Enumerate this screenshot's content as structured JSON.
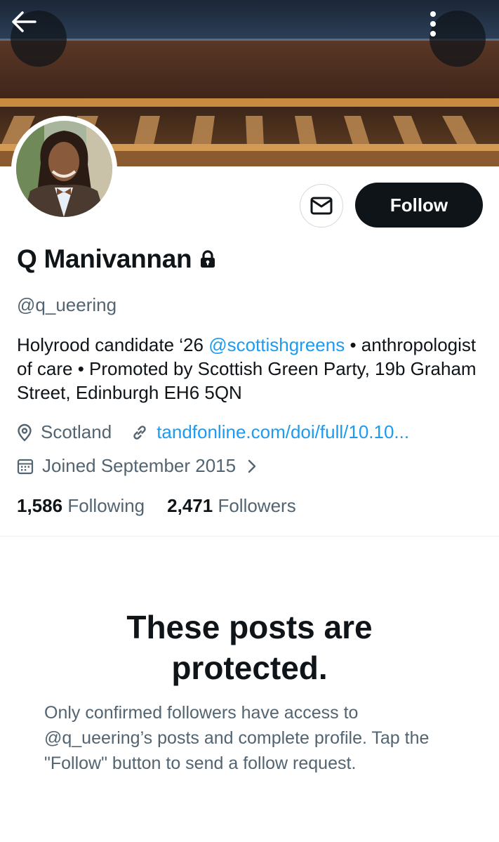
{
  "header": {
    "back_icon": "arrow-left-icon",
    "more_icon": "more-vertical-icon"
  },
  "profile": {
    "display_name": "Q Manivannan",
    "protected_icon": "lock-icon",
    "handle": "@q_ueering",
    "bio": {
      "part1": "Holyrood candidate ‘26 ",
      "mention": "@scottishgreens",
      "part2": " • anthropologist of care • Promoted by Scottish Green Party, 19b Graham Street, Edinburgh EH6 5QN"
    },
    "location": "Scotland",
    "website": "tandfonline.com/doi/full/10.10...",
    "joined": "Joined September 2015",
    "following_count": "1,586",
    "following_label": "Following",
    "followers_count": "2,471",
    "followers_label": "Followers"
  },
  "actions": {
    "message_icon": "envelope-icon",
    "follow_label": "Follow"
  },
  "protected_notice": {
    "title": "These posts are protected.",
    "body": "Only confirmed followers have access to @q_ueering’s posts and complete profile. Tap the \"Follow\" button to send a follow request."
  },
  "colors": {
    "link": "#1d9bf0",
    "primary_text": "#0f1419",
    "secondary_text": "#536471",
    "follow_bg": "#0f1419"
  }
}
